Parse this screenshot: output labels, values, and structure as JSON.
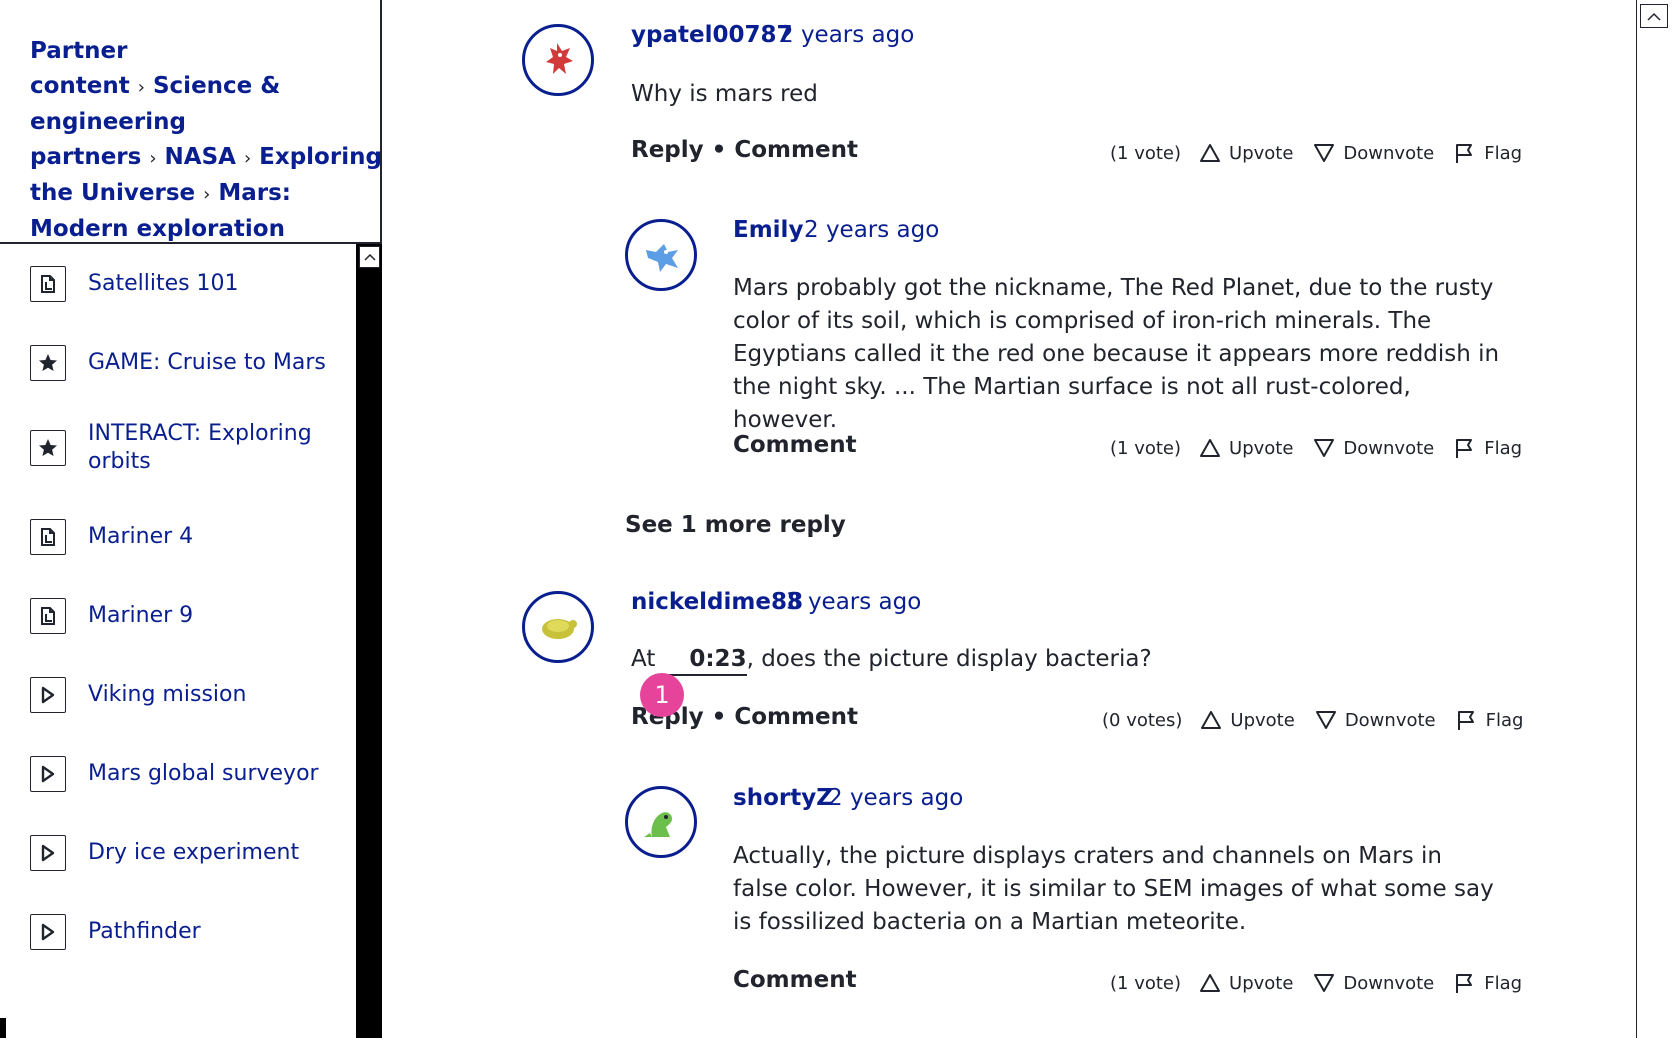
{
  "breadcrumb": {
    "items": [
      "Partner content",
      "Science & engineering partners",
      "NASA",
      "Exploring the Universe",
      "Mars: Modern exploration"
    ],
    "separator": "›"
  },
  "sidebar": {
    "items": [
      {
        "label": "Satellites 101",
        "icon": "article-icon"
      },
      {
        "label": "GAME: Cruise to Mars",
        "icon": "star-icon"
      },
      {
        "label": "INTERACT: Exploring orbits",
        "icon": "star-icon"
      },
      {
        "label": "Mariner 4",
        "icon": "article-icon"
      },
      {
        "label": "Mariner 9",
        "icon": "article-icon"
      },
      {
        "label": "Viking mission",
        "icon": "play-icon"
      },
      {
        "label": "Mars global surveyor",
        "icon": "play-icon"
      },
      {
        "label": "Dry ice experiment",
        "icon": "play-icon"
      },
      {
        "label": "Pathfinder",
        "icon": "play-icon"
      }
    ]
  },
  "actions": {
    "reply": "Reply",
    "dot": "•",
    "comment": "Comment",
    "upvote": "Upvote",
    "downvote": "Downvote",
    "flag": "Flag"
  },
  "comments": [
    {
      "author": "ypatel00787",
      "time": "2 years ago",
      "text": "Why is mars red",
      "votes": "(1 vote)",
      "replies": [
        {
          "author": "Emily",
          "time": "2 years ago",
          "text": "Mars probably got the nickname, The Red Planet, due to the rusty color of its soil, which is comprised of iron-rich minerals. The Egyptians called it the red one because it appears more reddish in the night sky. ... The Martian surface is not all rust-colored, however.",
          "votes": "(1 vote)"
        }
      ],
      "see_more": "See 1 more reply"
    },
    {
      "author": "nickeldime88",
      "time": "3 years ago",
      "text_before": "At",
      "timestamp": "0:23",
      "text_after": ", does the picture display bacteria?",
      "votes": "(0 votes)",
      "badge": "1",
      "replies": [
        {
          "author": "shortyZ",
          "time": "2 years ago",
          "text": "Actually, the picture displays craters and channels on Mars in false color. However, it is similar to SEM images of what some say is fossilized bacteria on a Martian meteorite.",
          "votes": "(1 vote)"
        }
      ]
    }
  ],
  "colors": {
    "link": "#0a1f8f",
    "badge": "#e6449b",
    "text": "#21242c"
  }
}
